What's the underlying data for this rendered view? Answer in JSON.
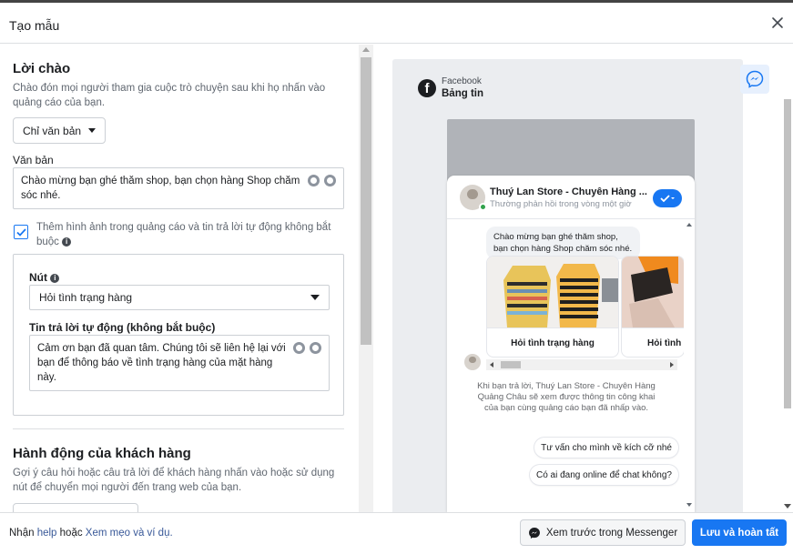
{
  "dialog": {
    "title": "Tạo mẫu"
  },
  "greeting": {
    "heading": "Lời chào",
    "description": "Chào đón mọi người tham gia cuộc trò chuyện sau khi họ nhấn vào quảng cáo của bạn.",
    "format_select": "Chỉ văn bản",
    "text_label": "Văn bản",
    "text_value": "Chào mừng bạn ghé thăm shop, bạn chọn hàng Shop chăm sóc nhé.",
    "checkbox_label": "Thêm hình ảnh trong quảng cáo và tin trả lời tự động không bắt buộc",
    "checkbox_checked": true,
    "button_label": "Nút",
    "button_value": "Hỏi tình trạng hàng",
    "auto_reply_label": "Tin trả lời tự động (không bắt buộc)",
    "auto_reply_value": "Cảm ơn bạn đã quan tâm. Chúng tôi sẽ liên hệ lại với bạn để thông báo về tình trạng hàng của mặt hàng này."
  },
  "customer_actions": {
    "heading": "Hành động của khách hàng",
    "description": "Gợi ý câu hỏi hoặc câu trả lời để khách hàng nhấn vào hoặc sử dụng nút để chuyển mọi người đến trang web của bạn."
  },
  "preview": {
    "source": "Facebook",
    "placement": "Bảng tin",
    "page_name": "Thuý Lan Store - Chuyên Hàng ...",
    "page_status": "Thường phản hồi trong vòng một giờ",
    "greeting_message": "Chào mừng bạn ghé thăm shop, bạn chọn hàng Shop chăm sóc nhé.",
    "cards": [
      {
        "button": "Hỏi tình trạng hàng"
      },
      {
        "button": "Hỏi tình"
      }
    ],
    "notice": "Khi bạn trả lời, Thuý Lan Store - Chuyên Hàng Quảng Châu sẽ xem được thông tin công khai của bạn cùng quảng cáo bạn đã nhấp vào.",
    "quick_replies": [
      "Tư vấn cho mình về kích cỡ nhé",
      "Có ai đang online để chat không?"
    ]
  },
  "footer": {
    "prefix": "Nhận",
    "help_link": "help",
    "middle": "hoặc",
    "tips_link": "Xem mẹo và ví dụ.",
    "preview_button": "Xem trước trong Messenger",
    "save_button": "Lưu và hoàn tất"
  },
  "colors": {
    "accent": "#1877f2",
    "link": "#385898",
    "online": "#31a24c"
  }
}
